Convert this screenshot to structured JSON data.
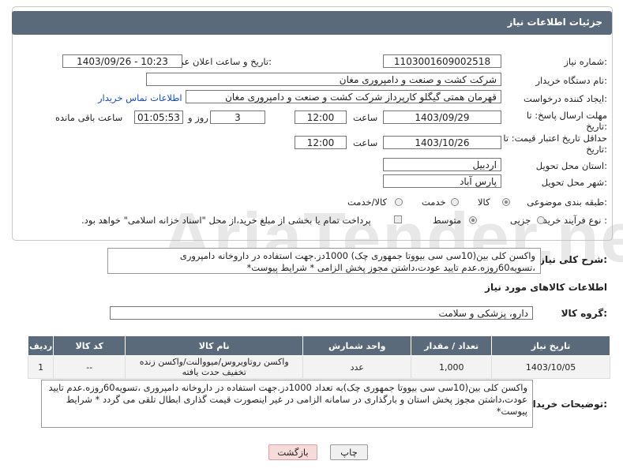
{
  "header": {
    "title": "جزئیات اطلاعات نیاز"
  },
  "fields": {
    "need_number_label": "شماره نیاز:",
    "need_number": "1103001609002518",
    "announce_label": "تاریخ و ساعت اعلان عمومی:",
    "announce_value": "1403/09/26 - 10:23",
    "buyer_org_label": "نام دستگاه خریدار:",
    "buyer_org": "شرکت کشت و صنعت و دامپروری مغان",
    "creator_label": "ایجاد کننده درخواست:",
    "creator": "قهرمان همتی گیگلو کارپرداز شرکت کشت و صنعت و دامپروری مغان",
    "contact_link": "اطلاعات تماس خریدار",
    "deadline_label": "مهلت ارسال پاسخ: تا تاریخ:",
    "deadline_date": "1403/09/29",
    "time_label": "ساعت",
    "deadline_time": "12:00",
    "days_value": "3",
    "days_label": "روز و",
    "remaining_value": "01:05:53",
    "remaining_label": "ساعت باقی مانده",
    "price_valid_label": "حداقل تاریخ اعتبار قیمت: تا تاریخ:",
    "price_valid_date": "1403/10/26",
    "price_valid_time": "12:00",
    "province_label": "استان محل تحویل:",
    "province": "اردبیل",
    "city_label": "شهر محل تحویل:",
    "city": "پارس آباد",
    "category_label": "طبقه بندی موضوعی:",
    "category_goods": "کالا",
    "category_service": "خدمت",
    "category_goods_service": "کالا/خدمت",
    "process_label": "نوع فرآیند خرید :",
    "process_partial": "جزیی",
    "process_medium": "متوسط",
    "process_note": "پرداخت تمام یا بخشی از مبلغ خرید،از محل \"اسناد خزانه اسلامی\" خواهد بود."
  },
  "summary": {
    "label": "شرح کلی نیاز:",
    "text": "واکسن کلی بین(10سی سی بیووتا جمهوری چک) 1000دز.جهت استفاده در داروخانه دامپروری ،تسویه60روزه.عدم تایید عودت،داشتن مجوز پخش الزامی * شرایط پیوست*"
  },
  "goods_info": {
    "title": "اطلاعات کالاهای مورد نیاز",
    "group_label": "گروه کالا:",
    "group_value": "دارو، پزشکی و سلامت"
  },
  "table": {
    "headers": [
      "ردیف",
      "کد کالا",
      "نام کالا",
      "واحد شمارش",
      "تعداد / مقدار",
      "تاریخ نیاز"
    ],
    "rows": [
      [
        "1",
        "--",
        "واکسن روتاویروس/میووالنت/واکسن زنده تخفیف حدت یافته",
        "عدد",
        "1,000",
        "1403/10/05"
      ]
    ]
  },
  "buyer_desc": {
    "label": "توضیحات خریدار:",
    "text": "واکسن کلی بین(10سی سی بیووتا جمهوری چک)به تعداد 1000دز.جهت استفاده در داروخانه دامپروری ،تسویه60روزه.عدم تایید عودت،داشتن مجوز پخش استان و بارگذاری در سامانه الزامی در غیر اینصورت قیمت گذاری ابطال تلقی می گردد * شرایط پیوست*"
  },
  "buttons": {
    "print": "چاپ",
    "back": "بازگشت"
  },
  "watermark": "AriaTender.neT"
}
